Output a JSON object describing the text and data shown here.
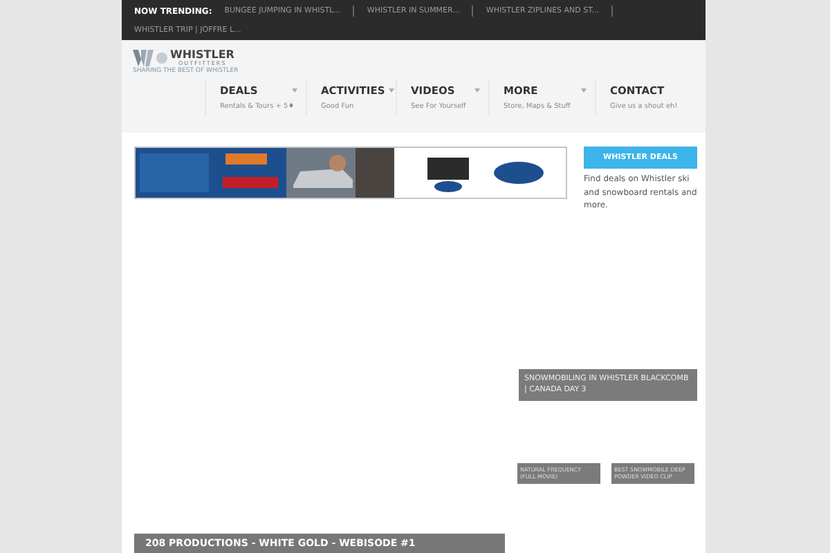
{
  "trending": {
    "label": "NOW TRENDING:",
    "links": [
      "BUNGEE JUMPING IN WHISTL...",
      "WHISTLER IN SUMMER...",
      "WHISTLER ZIPLINES AND ST...",
      "WHISTLER TRIP | JOFFRE L..."
    ]
  },
  "logo": {
    "name": "WHISTLER",
    "sub": "OUTFITTERS",
    "tagline": "SHARING THE BEST OF WHISTLER"
  },
  "nav": [
    {
      "label": "DEALS",
      "sub": "Rentals & Tours + 5♦",
      "has_menu": true
    },
    {
      "label": "ACTIVITIES",
      "sub": "Good Fun",
      "has_menu": true
    },
    {
      "label": "VIDEOS",
      "sub": "See For Yourself",
      "has_menu": true
    },
    {
      "label": "MORE",
      "sub": "Store, Maps & Stuff",
      "has_menu": true
    },
    {
      "label": "CONTACT",
      "sub": "Give us a shout eh!",
      "has_menu": false
    }
  ],
  "sidebar": {
    "button": "WHISTLER DEALS",
    "text": "Find deals on Whistler ski and snowboard rentals and more."
  },
  "videos": {
    "main": "SNOWMOBILING IN WHISTLER BLACKCOMB | CANADA DAY 3",
    "small": [
      "NATURAL FREQUENCY (FULL MOVIE)",
      "BEST SNOWMOBILE DEEP POWDER VIDEO CLIP"
    ]
  },
  "bottom_video": "208 PRODUCTIONS - WHITE GOLD - WEBISODE #1"
}
